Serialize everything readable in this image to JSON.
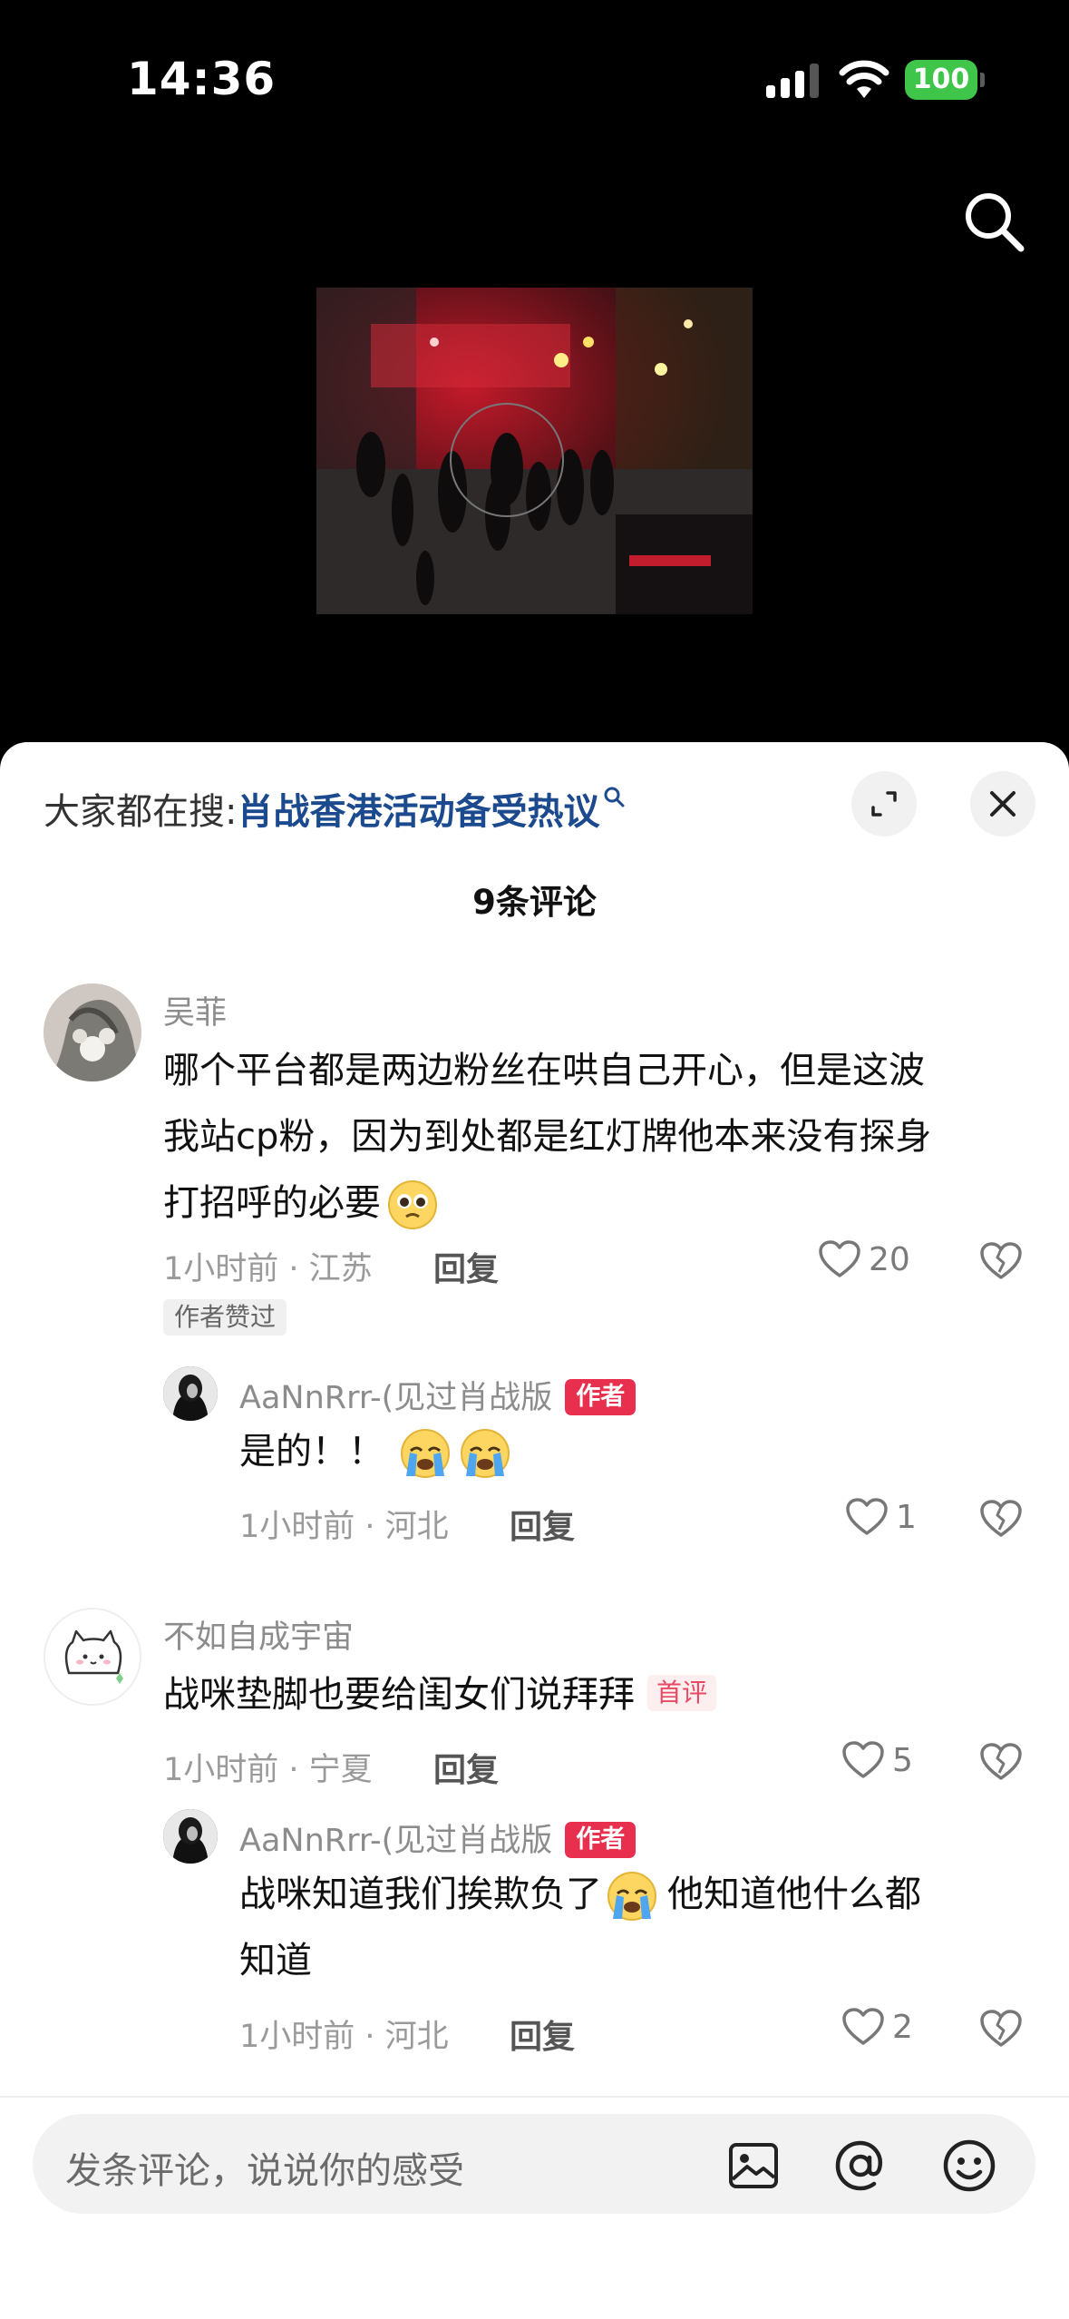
{
  "status_bar": {
    "time": "14:36",
    "battery": "100"
  },
  "hot_search": {
    "prefix": "大家都在搜:",
    "term": "肖战香港活动备受热议"
  },
  "comment_count": "9条评论",
  "comments": [
    {
      "name": "吴菲",
      "lines": [
        "哪个平台都是两边粉丝在哄自己开心，但是这波",
        "我站cp粉，因为到处都是红灯牌他本来没有探身",
        "打招呼的必要"
      ],
      "meta": "1小时前 · 江苏",
      "reply": "回复",
      "likes": "20",
      "badge": "作者赞过",
      "reply_item": {
        "name": "AaNnRrr-(见过肖战版",
        "badge": "作者",
        "text": "是的！！",
        "meta": "1小时前 · 河北",
        "reply": "回复",
        "likes": "1"
      }
    },
    {
      "name": "不如自成宇宙",
      "text": "战咪垫脚也要给闺女们说拜拜",
      "badge": "首评",
      "meta": "1小时前 · 宁夏",
      "reply": "回复",
      "likes": "5",
      "reply_item": {
        "name": "AaNnRrr-(见过肖战版",
        "badge": "作者",
        "lines": [
          "战咪知道我们挨欺负了",
          "知道"
        ],
        "line1_tail": "他知道他什么都",
        "meta": "1小时前 · 河北",
        "reply": "回复",
        "likes": "2"
      }
    }
  ],
  "input": {
    "placeholder": "发条评论，说说你的感受"
  },
  "colors": {
    "author_badge": "#e8304e",
    "hot_term": "#1c4a8e",
    "battery": "#3ec54a"
  }
}
